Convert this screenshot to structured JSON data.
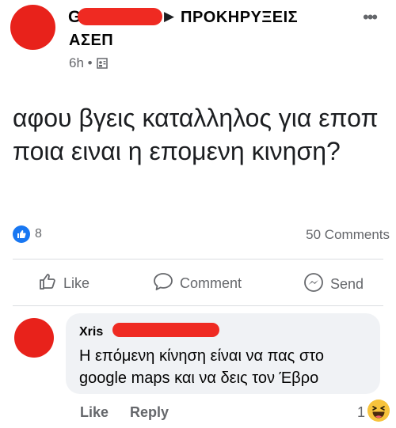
{
  "post": {
    "author_prefix": "G",
    "group_line1": "ΠΡΟΚΗΡΥΞΕΙΣ",
    "group_line2": "ΑΣΕΠ",
    "time": "6h",
    "time_separator": "•",
    "more": "•••",
    "text": "αφου βγεις καταλληλος για εποπ ποια ειναι η επομενη κινηση?"
  },
  "stats": {
    "reactions": "8",
    "comments": "50 Comments"
  },
  "actions": {
    "like": "Like",
    "comment": "Comment",
    "send": "Send"
  },
  "comment": {
    "author_prefix": "Xris",
    "text": "Η επόμενη κίνηση είναι να πας στο google maps και να δεις τον Έβρο",
    "like": "Like",
    "reply": "Reply",
    "reaction_count": "1"
  },
  "colors": {
    "accent": "#1877f2",
    "redaction": "#ef2a22",
    "secondary_text": "#65676b"
  }
}
